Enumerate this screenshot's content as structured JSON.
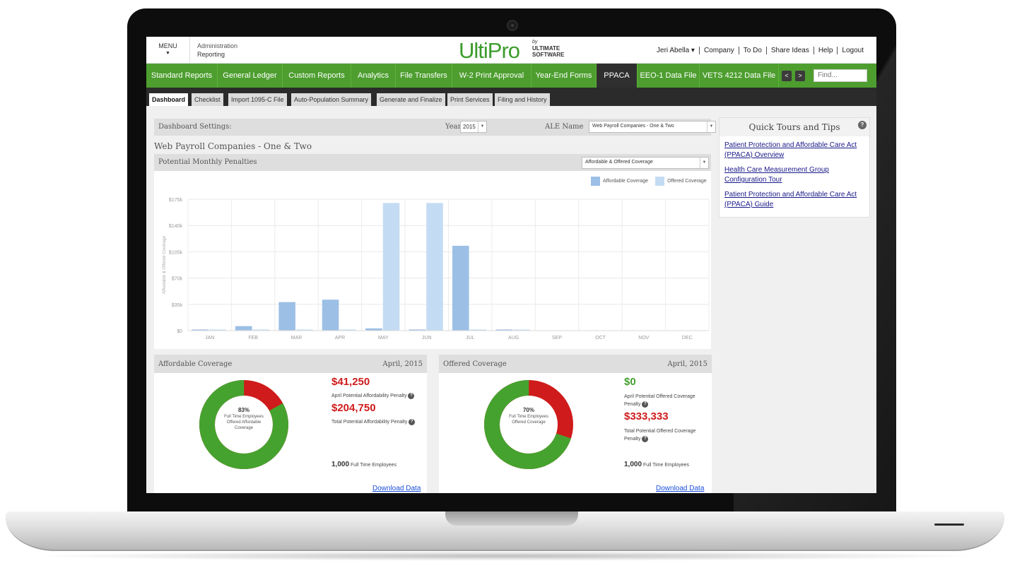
{
  "colors": {
    "brand_green": "#4d9e2f",
    "bar_affordable": "#9cbfe6",
    "bar_offered": "#c4dcf3",
    "donut_green": "#46a22f",
    "donut_red": "#cf1b1b",
    "penalty_red": "#cf1b1b",
    "link_blue": "#1a4fd8"
  },
  "topbar": {
    "menu_label": "MENU",
    "breadcrumb_top": "Administration",
    "breadcrumb_sub": "Reporting",
    "logo_text": "UltiPro",
    "logo_by": "by",
    "logo_company_1": "ULTIMATE",
    "logo_company_2": "SOFTWARE",
    "user_name": "Jeri Abella ▾",
    "links": [
      "Company",
      "To Do",
      "Share Ideas",
      "Help",
      "Logout"
    ]
  },
  "nav": {
    "items": [
      "Standard Reports",
      "General Ledger",
      "Custom Reports",
      "Analytics",
      "File Transfers",
      "W-2 Print Approval",
      "Year-End Forms",
      "PPACA",
      "EEO-1 Data File",
      "VETS 4212 Data File"
    ],
    "active": "PPACA",
    "prev_arrow": "<",
    "next_arrow": ">",
    "find_placeholder": "Find..."
  },
  "subnav": {
    "tabs": [
      "Dashboard",
      "Checklist",
      "Import 1095-C File",
      "Auto-Population Summary",
      "Generate and Finalize",
      "Print Services",
      "Filing and History"
    ],
    "active": "Dashboard"
  },
  "settings": {
    "label": "Dashboard Settings:",
    "year_label": "Year",
    "year_value": "2015",
    "ale_label": "ALE Name",
    "ale_value": "Web Payroll Companies - One & Two"
  },
  "company_title": "Web Payroll Companies - One & Two",
  "chart_panel": {
    "title": "Potential Monthly Penalties",
    "select_value": "Affordable & Offered Coverage"
  },
  "chart_data": {
    "type": "bar",
    "categories": [
      "JAN",
      "FEB",
      "MAR",
      "APR",
      "MAY",
      "JUN",
      "JUL",
      "AUG",
      "SEP",
      "OCT",
      "NOV",
      "DEC"
    ],
    "series": [
      {
        "name": "Affordable Coverage",
        "values": [
          1500,
          6000,
          38000,
          41250,
          3000,
          1500,
          113000,
          1500,
          0,
          0,
          0,
          0
        ]
      },
      {
        "name": "Offered Coverage",
        "values": [
          1500,
          1500,
          1500,
          1500,
          170000,
          170000,
          1500,
          1500,
          0,
          0,
          0,
          0
        ]
      }
    ],
    "ylabel": "Affordable & Offered Coverage",
    "ylim": [
      0,
      175000
    ],
    "yticks": [
      "$0",
      "$35k",
      "$70k",
      "$105k",
      "$140k",
      "$175k"
    ],
    "grid": true,
    "legend": "top-right"
  },
  "affordable_card": {
    "title": "Affordable Coverage",
    "period": "April, 2015",
    "donut_pct": "83%",
    "donut_caption": "Full Time Employees Offered Affordable Coverage",
    "donut_value": 0.83,
    "monthly_penalty": "$41,250",
    "monthly_caption": "April Potential Affordability Penalty",
    "total_penalty": "$204,750",
    "total_caption": "Total Potential Affordability Penalty",
    "employees": "1,000",
    "employees_caption": "Full Time Employees",
    "download": "Download Data"
  },
  "offered_card": {
    "title": "Offered Coverage",
    "period": "April, 2015",
    "donut_pct": "70%",
    "donut_caption": "Full Time Employees Offered Coverage",
    "donut_value": 0.7,
    "monthly_penalty": "$0",
    "monthly_caption": "April Potential Offered Coverage Penalty",
    "total_penalty": "$333,333",
    "total_caption": "Total Potential Offered Coverage Penalty",
    "employees": "1,000",
    "employees_caption": "Full Time Employees",
    "download": "Download Data"
  },
  "tips": {
    "title": "Quick Tours and Tips",
    "help": "?",
    "links": [
      "Patient Protection and Affordable Care Act (PPACA) Overview",
      "Health Care Measurement Group Configuration Tour",
      "Patient Protection and Affordable Care Act (PPACA) Guide"
    ]
  }
}
